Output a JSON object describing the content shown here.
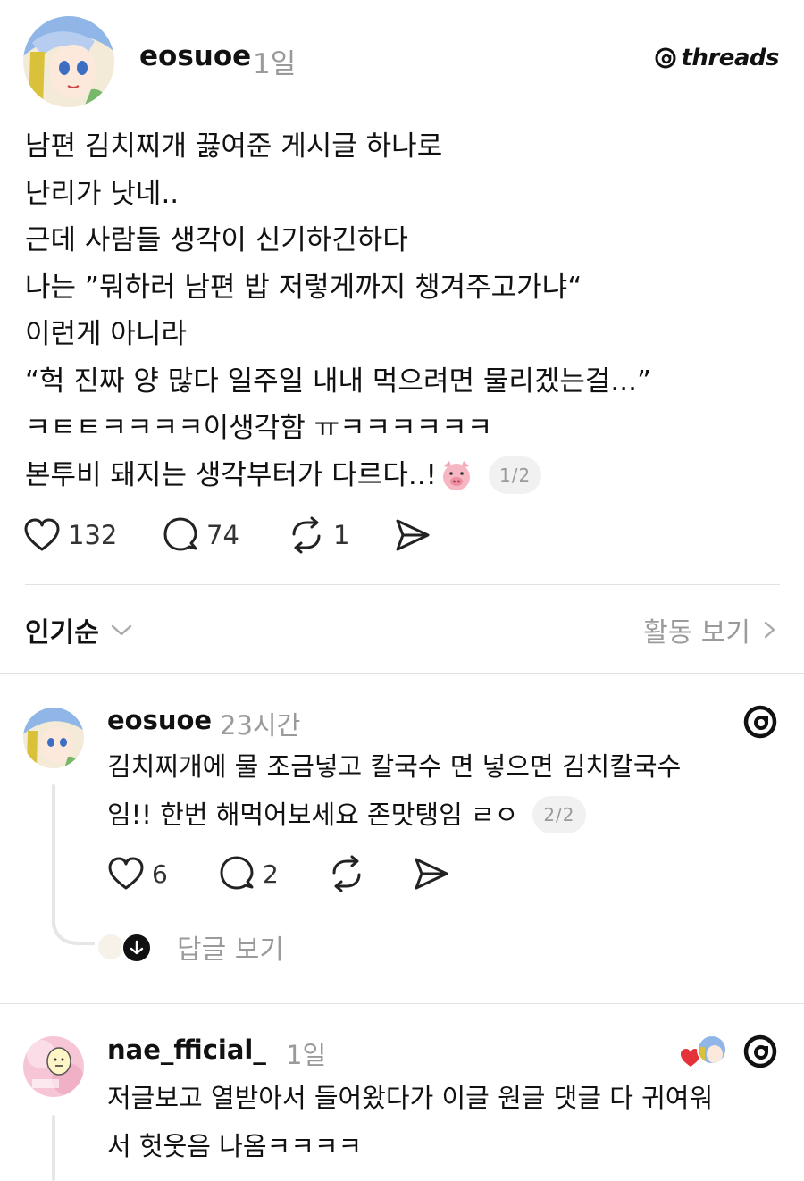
{
  "post": {
    "username": "eosuoe",
    "time": "1일",
    "brand": "threads",
    "lines": [
      "남편 김치찌개 끓여준 게시글 하나로",
      "난리가 낫네..",
      "근데 사람들 생각이 신기하긴하다",
      "나는 ”뭐하러 남편 밥 저렇게까지 챙겨주고가냐“",
      "이런게 아니라",
      "“헉 진짜 양 많다 일주일 내내 먹으려면 물리겠는걸...”",
      "ㅋㅌㅌㅋㅋㅋㅋ이생각함 ㅠㅋㅋㅋㅋㅋㅋ",
      "본투비 돼지는 생각부터가 다르다..!"
    ],
    "pager": "1/2",
    "likes": "132",
    "comments": "74",
    "reposts": "1"
  },
  "sort": {
    "label": "인기순",
    "activity": "활동 보기"
  },
  "replies": [
    {
      "username": "eosuoe",
      "time": "23시간",
      "lines": [
        "김치찌개에 물 조금넣고 칼국수 면 넣으면 김치칼국수",
        "임!! 한번 해먹어보세요 존맛탱임 ㄹㅇ"
      ],
      "pager": "2/2",
      "likes": "6",
      "comments": "2",
      "view_replies": "답글 보기"
    },
    {
      "username": "nae_fficial_",
      "time": "1일",
      "lines": [
        "저글보고 열받아서 들어왔다가 이글 원글 댓글 다 귀여워",
        "서 헛웃음 나옴ㅋㅋㅋㅋ"
      ]
    }
  ],
  "colors": {
    "text": "#111111",
    "muted": "#9a9a9a",
    "divider": "#e2e2e2",
    "heart": "#e5323a"
  },
  "icons": [
    "heart-icon",
    "comment-icon",
    "repost-icon",
    "share-icon",
    "threads-logo-icon",
    "chevron-down-icon",
    "chevron-right-icon",
    "pig-emoji-icon"
  ]
}
